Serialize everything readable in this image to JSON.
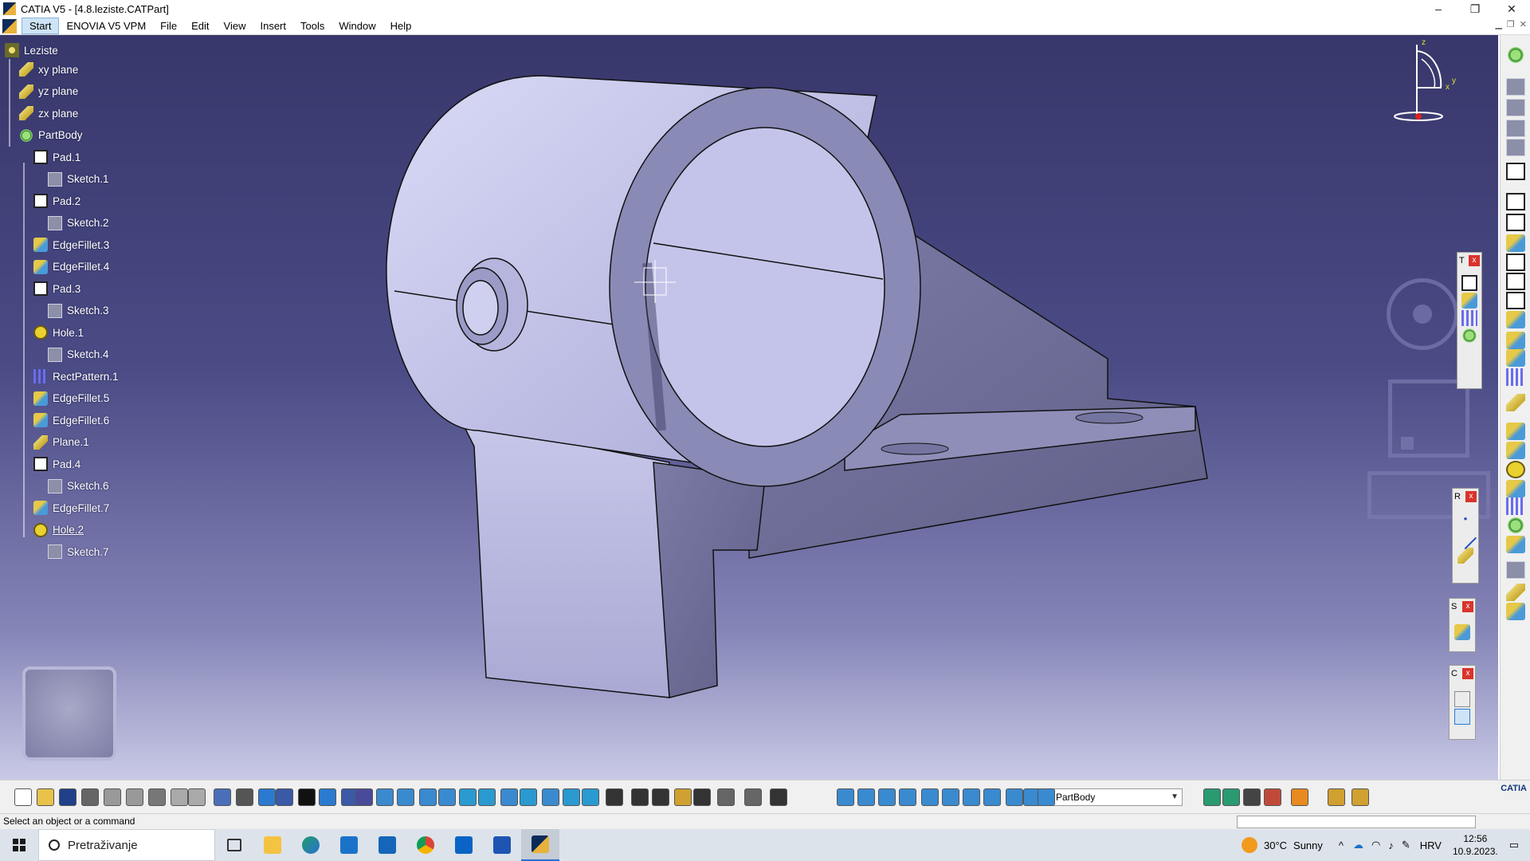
{
  "window": {
    "title": "CATIA V5 - [4.8.leziste.CATPart]",
    "controls": [
      "–",
      "❐",
      "✕"
    ]
  },
  "menu": {
    "items": [
      "Start",
      "ENOVIA V5 VPM",
      "File",
      "Edit",
      "View",
      "Insert",
      "Tools",
      "Window",
      "Help"
    ]
  },
  "tree": {
    "root": "Leziste",
    "nodes": [
      {
        "label": "xy plane",
        "icon": "plane-icon"
      },
      {
        "label": "yz plane",
        "icon": "plane-icon"
      },
      {
        "label": "zx plane",
        "icon": "plane-icon"
      },
      {
        "label": "PartBody",
        "icon": "partbody-icon"
      },
      {
        "label": "Pad.1",
        "icon": "pad-icon"
      },
      {
        "label": "Sketch.1",
        "icon": "sketch-icon"
      },
      {
        "label": "Pad.2",
        "icon": "pad-icon"
      },
      {
        "label": "Sketch.2",
        "icon": "sketch-icon"
      },
      {
        "label": "EdgeFillet.3",
        "icon": "fillet-icon"
      },
      {
        "label": "EdgeFillet.4",
        "icon": "fillet-icon"
      },
      {
        "label": "Pad.3",
        "icon": "pad-icon"
      },
      {
        "label": "Sketch.3",
        "icon": "sketch-icon"
      },
      {
        "label": "Hole.1",
        "icon": "hole-icon"
      },
      {
        "label": "Sketch.4",
        "icon": "sketch-icon"
      },
      {
        "label": "RectPattern.1",
        "icon": "pattern-icon"
      },
      {
        "label": "EdgeFillet.5",
        "icon": "fillet-icon"
      },
      {
        "label": "EdgeFillet.6",
        "icon": "fillet-icon"
      },
      {
        "label": "Plane.1",
        "icon": "plane-icon"
      },
      {
        "label": "Pad.4",
        "icon": "pad-icon"
      },
      {
        "label": "Sketch.6",
        "icon": "sketch-icon"
      },
      {
        "label": "EdgeFillet.7",
        "icon": "fillet-icon"
      },
      {
        "label": "Hole.2",
        "icon": "hole-icon",
        "selected": true
      },
      {
        "label": "Sketch.7",
        "icon": "sketch-icon"
      }
    ]
  },
  "compass": {
    "z": "z",
    "x": "x",
    "y": "y"
  },
  "floating_toolbars": [
    {
      "title": "T"
    },
    {
      "title": "R"
    },
    {
      "title": "S"
    },
    {
      "title": "C"
    }
  ],
  "toolbar": {
    "body_select": "PartBody"
  },
  "status": {
    "message": "Select an object or a command"
  },
  "taskbar": {
    "search_placeholder": "Pretraživanje",
    "weather_temp": "30°C",
    "weather_text": "Sunny",
    "language": "HRV",
    "time": "12:56",
    "date": "10.9.2023."
  },
  "colors": {
    "viewport_top": "#37376b",
    "viewport_bottom": "#c9c9e6",
    "model_face": "#b9b9e0",
    "model_dark": "#6c6c94"
  }
}
